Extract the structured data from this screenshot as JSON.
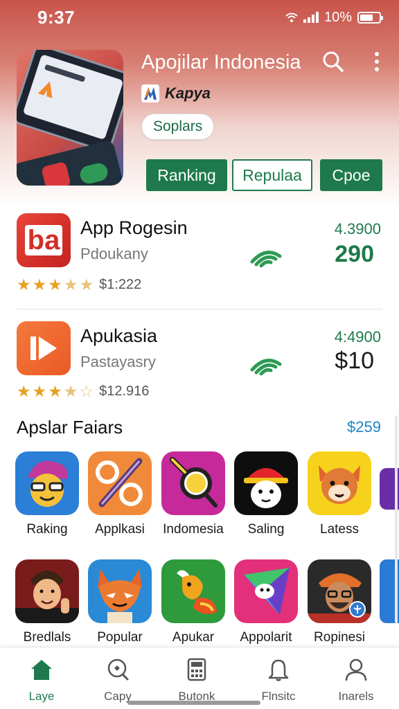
{
  "status_bar": {
    "time": "9:37",
    "battery": "10%"
  },
  "header": {
    "title": "Apojilar Indonesia",
    "brand": "Kapya",
    "chip": "Soplars",
    "tabs": [
      {
        "label": "Ranking",
        "style": "filled"
      },
      {
        "label": "Repulaa",
        "style": "outline"
      },
      {
        "label": "Cpoe",
        "style": "filled"
      }
    ]
  },
  "apps": [
    {
      "name": "App Rogesin",
      "subtitle": "Pdoukany",
      "icon_text": "ba",
      "icon": "ba-logo-icon",
      "stars_price": "$1:222",
      "rating": "4.3900",
      "count": "290",
      "count_color": "#1e7a4c"
    },
    {
      "name": "Apukasia",
      "subtitle": "Pastayasry",
      "icon": "play-icon",
      "stars_price": "$12.916",
      "rating": "4:4900",
      "count": "$10",
      "count_color": "#1b1b1b"
    }
  ],
  "section": {
    "title": "Apslar Faiars",
    "link": "$259"
  },
  "grid_row1": [
    "Raking",
    "Applkasi",
    "Indomesia",
    "Saling",
    "Latess"
  ],
  "grid_row2": [
    "Bredlals",
    "Popular",
    "Apukar",
    "Appolarit",
    "Ropinesi"
  ],
  "nav": [
    "Laye",
    "Capy",
    "Butonk",
    "Flnsitc",
    "Inarels"
  ],
  "colors": {
    "accent": "#1e7a4c",
    "header": "#c9534a",
    "link": "#1c86c2",
    "star": "#e6a21c"
  }
}
